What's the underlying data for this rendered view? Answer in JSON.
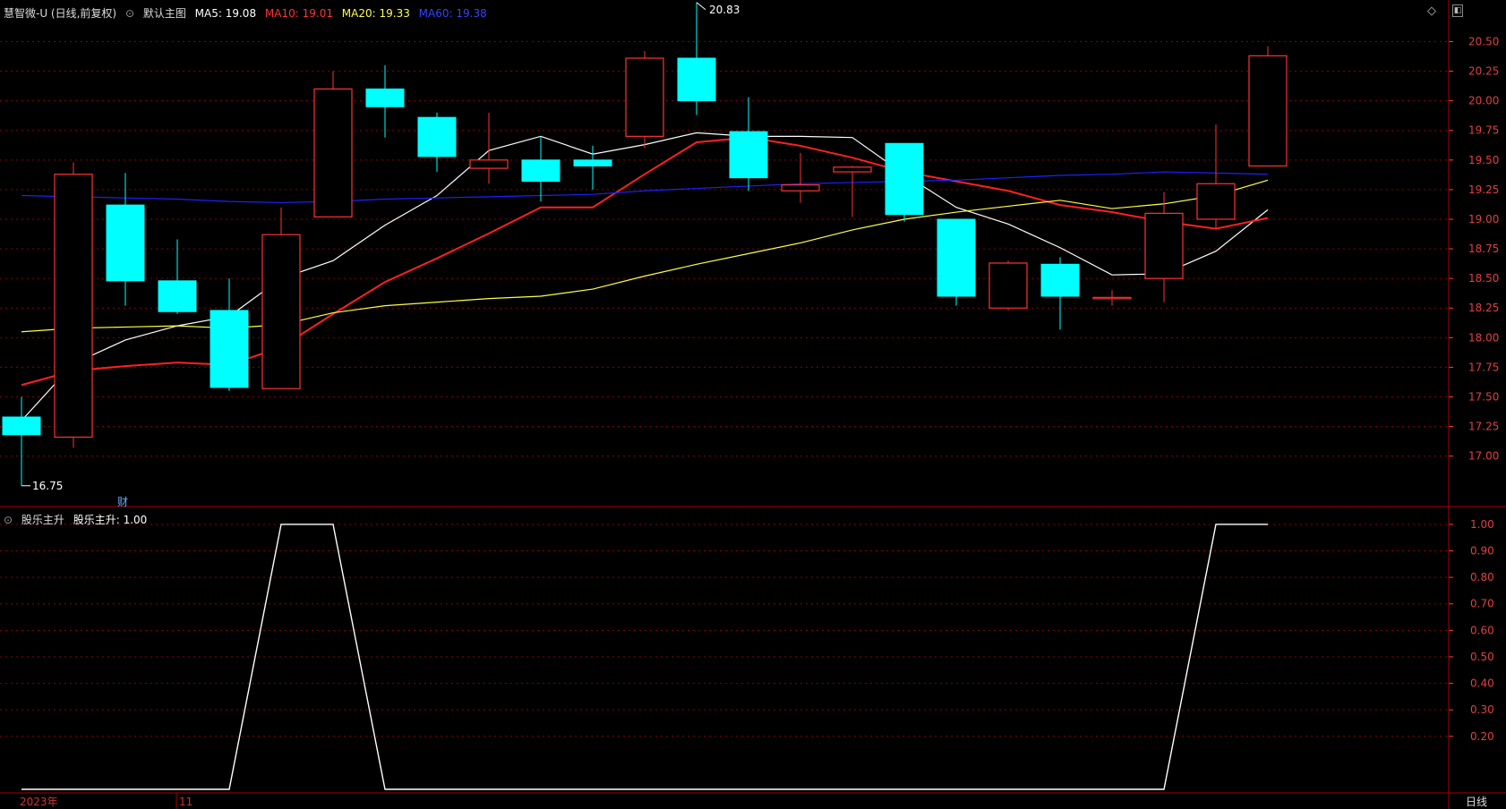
{
  "header": {
    "stock": "慧智微-U (日线,前复权)",
    "template": "默认主图",
    "ma5": "MA5: 19.08",
    "ma10": "MA10: 19.01",
    "ma20": "MA20: 19.33",
    "ma60": "MA60: 19.38"
  },
  "indicator": {
    "label": "股乐主升",
    "value": "股乐主升: 1.00"
  },
  "footer": {
    "year": "2023年",
    "month": "11",
    "period": "日线"
  },
  "markers": {
    "fin": "财",
    "high": "20.83",
    "low": "16.75"
  },
  "colors": {
    "up": "#ff3232",
    "down": "#00ffff",
    "ma5": "#ffffff",
    "ma10": "#ff2020",
    "ma20": "#ffff40",
    "ma60": "#2020ff",
    "grid": "#8b0000",
    "axis": "#ff4444"
  },
  "chart_data": [
    {
      "type": "candlestick",
      "ylim": [
        16.65,
        20.7
      ],
      "yticks": [
        "17.00",
        "17.25",
        "17.50",
        "17.75",
        "18.00",
        "18.25",
        "18.50",
        "18.75",
        "19.00",
        "19.25",
        "19.50",
        "19.75",
        "20.00",
        "20.25",
        "20.50"
      ],
      "candles": [
        {
          "o": 17.33,
          "h": 17.5,
          "l": 16.75,
          "c": 17.18
        },
        {
          "o": 17.16,
          "h": 19.48,
          "l": 17.07,
          "c": 19.38
        },
        {
          "o": 19.12,
          "h": 19.39,
          "l": 18.27,
          "c": 18.48
        },
        {
          "o": 18.48,
          "h": 18.83,
          "l": 18.2,
          "c": 18.22
        },
        {
          "o": 18.23,
          "h": 18.5,
          "l": 17.55,
          "c": 17.58
        },
        {
          "o": 17.57,
          "h": 19.1,
          "l": 17.57,
          "c": 18.87
        },
        {
          "o": 19.02,
          "h": 20.25,
          "l": 19.02,
          "c": 20.1
        },
        {
          "o": 20.1,
          "h": 20.3,
          "l": 19.69,
          "c": 19.95
        },
        {
          "o": 19.86,
          "h": 19.9,
          "l": 19.4,
          "c": 19.53
        },
        {
          "o": 19.43,
          "h": 19.9,
          "l": 19.3,
          "c": 19.5
        },
        {
          "o": 19.5,
          "h": 19.7,
          "l": 19.15,
          "c": 19.32
        },
        {
          "o": 19.5,
          "h": 19.62,
          "l": 19.25,
          "c": 19.45
        },
        {
          "o": 19.7,
          "h": 20.42,
          "l": 19.6,
          "c": 20.36
        },
        {
          "o": 20.36,
          "h": 20.83,
          "l": 19.88,
          "c": 20.0
        },
        {
          "o": 19.74,
          "h": 20.03,
          "l": 19.24,
          "c": 19.35
        },
        {
          "o": 19.24,
          "h": 19.56,
          "l": 19.14,
          "c": 19.29
        },
        {
          "o": 19.4,
          "h": 19.45,
          "l": 19.02,
          "c": 19.44
        },
        {
          "o": 19.64,
          "h": 19.64,
          "l": 18.98,
          "c": 19.04
        },
        {
          "o": 19.0,
          "h": 19.0,
          "l": 18.27,
          "c": 18.35
        },
        {
          "o": 18.25,
          "h": 18.65,
          "l": 18.23,
          "c": 18.63
        },
        {
          "o": 18.62,
          "h": 18.68,
          "l": 18.07,
          "c": 18.35
        },
        {
          "o": 18.33,
          "h": 18.4,
          "l": 18.27,
          "c": 18.34
        },
        {
          "o": 18.5,
          "h": 19.23,
          "l": 18.3,
          "c": 19.05
        },
        {
          "o": 19.0,
          "h": 19.8,
          "l": 18.92,
          "c": 19.3
        },
        {
          "o": 19.45,
          "h": 20.46,
          "l": 19.45,
          "c": 20.38
        }
      ],
      "series": [
        {
          "name": "MA5",
          "values": [
            17.3,
            17.78,
            17.98,
            18.1,
            18.18,
            18.5,
            18.65,
            18.95,
            19.2,
            19.58,
            19.7,
            19.55,
            19.63,
            19.73,
            19.7,
            19.7,
            19.69,
            19.38,
            19.1,
            18.96,
            18.76,
            18.53,
            18.54,
            18.73,
            19.08
          ]
        },
        {
          "name": "MA10",
          "values": [
            17.6,
            17.72,
            17.76,
            17.79,
            17.77,
            17.92,
            18.2,
            18.47,
            18.67,
            18.88,
            19.1,
            19.1,
            19.38,
            19.65,
            19.69,
            19.62,
            19.52,
            19.4,
            19.32,
            19.24,
            19.12,
            19.06,
            18.98,
            18.92,
            19.01
          ]
        },
        {
          "name": "MA20",
          "values": [
            18.05,
            18.08,
            18.09,
            18.1,
            18.08,
            18.11,
            18.21,
            18.27,
            18.3,
            18.33,
            18.35,
            18.41,
            18.52,
            18.62,
            18.71,
            18.8,
            18.91,
            19.0,
            19.06,
            19.11,
            19.16,
            19.09,
            19.13,
            19.2,
            19.33
          ]
        },
        {
          "name": "MA60",
          "values": [
            19.2,
            19.19,
            19.18,
            19.17,
            19.15,
            19.14,
            19.15,
            19.17,
            19.18,
            19.19,
            19.2,
            19.21,
            19.24,
            19.26,
            19.28,
            19.3,
            19.31,
            19.32,
            19.33,
            19.35,
            19.37,
            19.38,
            19.4,
            19.39,
            19.38
          ]
        }
      ]
    },
    {
      "type": "line",
      "ylim": [
        0,
        1.02
      ],
      "yticks": [
        "0.20",
        "0.30",
        "0.40",
        "0.50",
        "0.60",
        "0.70",
        "0.80",
        "0.90",
        "1.00"
      ],
      "series": [
        {
          "name": "股乐主升",
          "values": [
            0,
            0,
            0,
            0,
            0,
            1,
            1,
            0,
            0,
            0,
            0,
            0,
            0,
            0,
            0,
            0,
            0,
            0,
            0,
            0,
            0,
            0,
            0,
            1,
            1
          ]
        }
      ]
    }
  ]
}
